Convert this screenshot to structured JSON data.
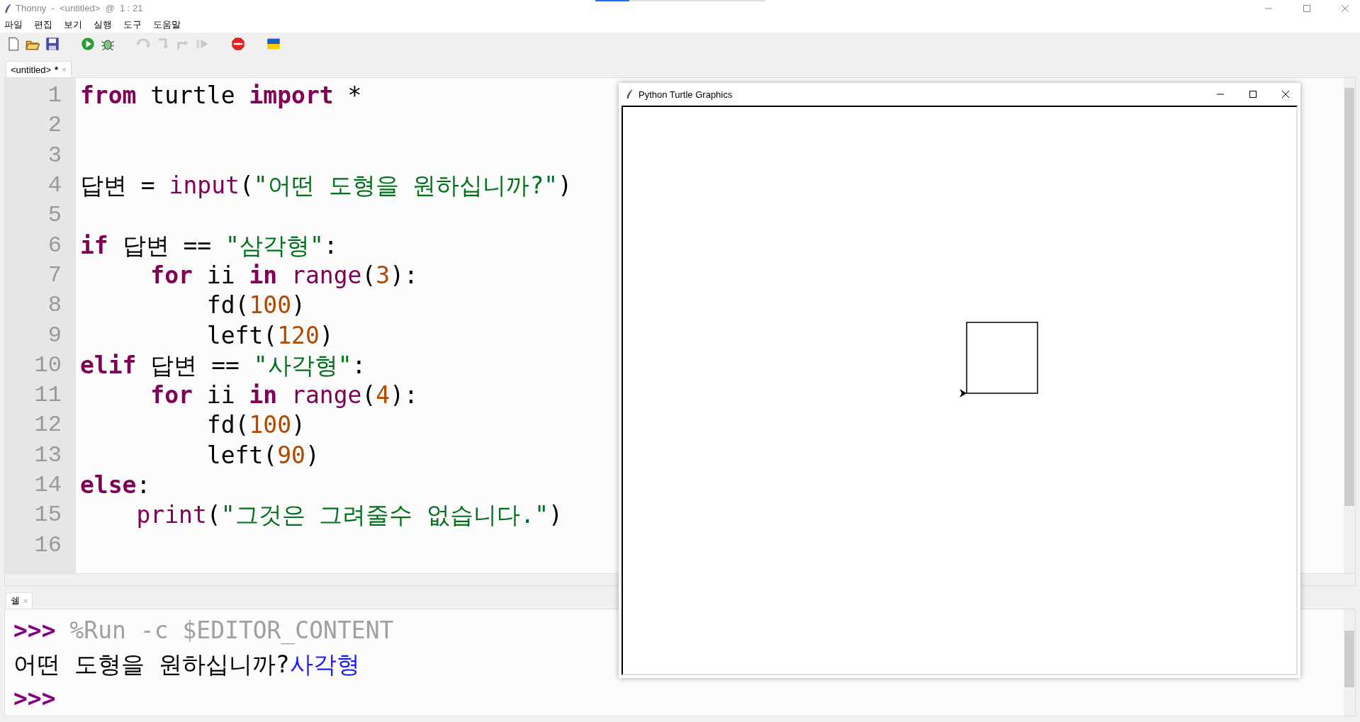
{
  "window": {
    "title": "Thonny  -  <untitled>  @  1 : 21"
  },
  "menu": [
    "파일",
    "편집",
    "보기",
    "실행",
    "도구",
    "도움말"
  ],
  "toolbar": [
    {
      "kind": "new",
      "disabled": false
    },
    {
      "kind": "open",
      "disabled": false
    },
    {
      "kind": "save",
      "disabled": false
    },
    {
      "kind": "run",
      "disabled": false
    },
    {
      "kind": "debug",
      "disabled": false
    },
    {
      "kind": "step-over",
      "disabled": true
    },
    {
      "kind": "step-into",
      "disabled": true
    },
    {
      "kind": "step-out",
      "disabled": true
    },
    {
      "kind": "resume",
      "disabled": true
    },
    {
      "kind": "stop",
      "disabled": false
    },
    {
      "kind": "flag",
      "disabled": false
    }
  ],
  "editor_tabs": [
    {
      "label": "<untitled>",
      "modified_mark": "*",
      "close": "×",
      "selected": true
    }
  ],
  "editor": {
    "lines": [
      {
        "number": "1",
        "tokens": [
          {
            "kind": "keyword",
            "text": "from"
          },
          {
            "kind": "plain",
            "text": " turtle "
          },
          {
            "kind": "keyword",
            "text": "import"
          },
          {
            "kind": "plain",
            "text": " *"
          }
        ]
      },
      {
        "number": "2"
      },
      {
        "number": "3"
      },
      {
        "number": "4",
        "tokens": [
          {
            "kind": "plain",
            "text": "답변 = "
          },
          {
            "kind": "builtin",
            "text": "input"
          },
          {
            "kind": "plain",
            "text": "("
          },
          {
            "kind": "string",
            "text": "\"어떤 도형을 원하십니까?\""
          },
          {
            "kind": "plain",
            "text": ")"
          }
        ]
      },
      {
        "number": "5"
      },
      {
        "number": "6",
        "tokens": [
          {
            "kind": "keyword",
            "text": "if"
          },
          {
            "kind": "plain",
            "text": " 답변 == "
          },
          {
            "kind": "string",
            "text": "\"삼각형\""
          },
          {
            "kind": "plain",
            "text": ":"
          }
        ]
      },
      {
        "number": "7",
        "tokens": [
          {
            "kind": "keyword",
            "text": "     for"
          },
          {
            "kind": "plain",
            "text": " ii "
          },
          {
            "kind": "keyword",
            "text": "in"
          },
          {
            "kind": "builtin",
            "text": " range"
          },
          {
            "kind": "plain",
            "text": "("
          },
          {
            "kind": "number",
            "text": "3"
          },
          {
            "kind": "plain",
            "text": "):"
          }
        ]
      },
      {
        "number": "8",
        "tokens": [
          {
            "kind": "plain",
            "text": "         fd("
          },
          {
            "kind": "number",
            "text": "100"
          },
          {
            "kind": "plain",
            "text": ")"
          }
        ]
      },
      {
        "number": "9",
        "tokens": [
          {
            "kind": "plain",
            "text": "         left("
          },
          {
            "kind": "number",
            "text": "120"
          },
          {
            "kind": "plain",
            "text": ")"
          }
        ]
      },
      {
        "number": "10",
        "tokens": [
          {
            "kind": "keyword",
            "text": "elif"
          },
          {
            "kind": "plain",
            "text": " 답변 == "
          },
          {
            "kind": "string",
            "text": "\"사각형\""
          },
          {
            "kind": "plain",
            "text": ":"
          }
        ]
      },
      {
        "number": "11",
        "tokens": [
          {
            "kind": "keyword",
            "text": "     for"
          },
          {
            "kind": "plain",
            "text": " ii "
          },
          {
            "kind": "keyword",
            "text": "in"
          },
          {
            "kind": "builtin",
            "text": " range"
          },
          {
            "kind": "plain",
            "text": "("
          },
          {
            "kind": "number",
            "text": "4"
          },
          {
            "kind": "plain",
            "text": "):"
          }
        ]
      },
      {
        "number": "12",
        "tokens": [
          {
            "kind": "plain",
            "text": "         fd("
          },
          {
            "kind": "number",
            "text": "100"
          },
          {
            "kind": "plain",
            "text": ")"
          }
        ]
      },
      {
        "number": "13",
        "tokens": [
          {
            "kind": "plain",
            "text": "         left("
          },
          {
            "kind": "number",
            "text": "90"
          },
          {
            "kind": "plain",
            "text": ")"
          }
        ]
      },
      {
        "number": "14",
        "tokens": [
          {
            "kind": "keyword",
            "text": "else"
          },
          {
            "kind": "plain",
            "text": ":"
          }
        ]
      },
      {
        "number": "15",
        "tokens": [
          {
            "kind": "builtin",
            "text": "    print"
          },
          {
            "kind": "plain",
            "text": "("
          },
          {
            "kind": "string",
            "text": "\"그것은 그려줄수 없습니다.\""
          },
          {
            "kind": "plain",
            "text": ")"
          }
        ]
      },
      {
        "number": "16"
      }
    ]
  },
  "shell_tab": {
    "label": "쉘",
    "close": "×",
    "selected": true
  },
  "shell": {
    "lines": [
      {
        "tokens": [
          {
            "kind": "prompt",
            "text": ">>>"
          },
          {
            "kind": "command",
            "text": " %Run -c $EDITOR_CONTENT"
          }
        ]
      },
      {
        "tokens": [
          {
            "kind": "output",
            "text": "어떤 도형을 원하십니까?"
          },
          {
            "kind": "input",
            "text": "사각형"
          }
        ]
      },
      {
        "tokens": [
          {
            "kind": "prompt",
            "text": ">>>"
          }
        ]
      }
    ]
  },
  "turtle_window": {
    "title": "Python Turtle Graphics"
  }
}
